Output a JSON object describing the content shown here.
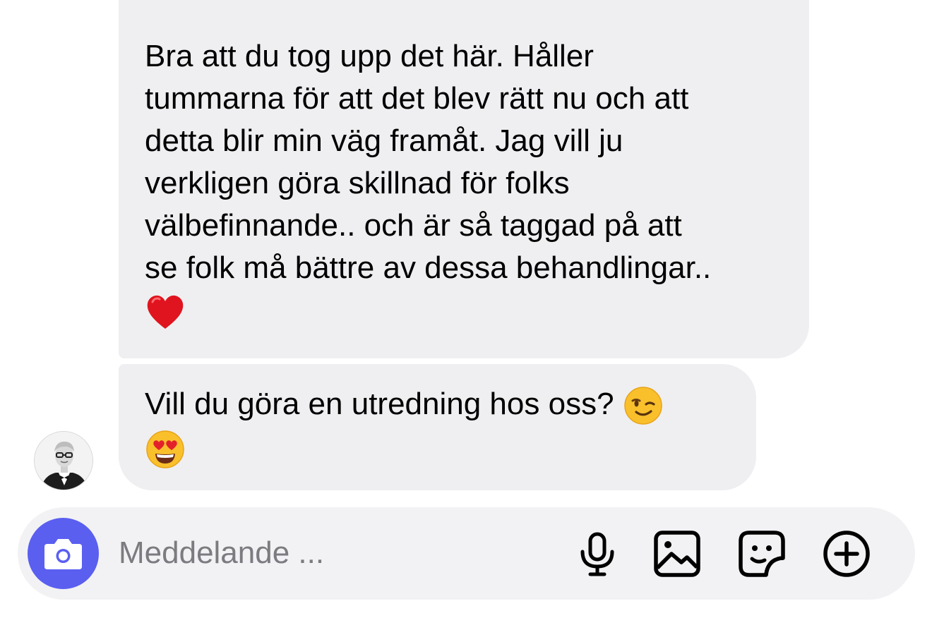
{
  "messages": [
    {
      "lines": [
        "Bra att du tog upp det här. Håller",
        "tummarna för att det blev rätt nu och att",
        "detta blir min väg framåt. Jag vill ju",
        "verkligen göra skillnad för folks",
        "välbefinnande.. och är så taggad på att",
        "se folk må bättre av dessa behandlingar.."
      ],
      "emoji": "❤️"
    },
    {
      "lines": [
        "Vill du göra en utredning hos oss?"
      ],
      "emoji_inline": "😉",
      "emoji": "😍"
    }
  ],
  "composer": {
    "placeholder": "Meddelande ...",
    "value": ""
  },
  "icons": {
    "camera": "camera-icon",
    "microphone": "microphone-icon",
    "gallery": "image-icon",
    "sticker": "sticker-icon",
    "add": "plus-circle-icon"
  },
  "colors": {
    "bubble": "#efeff1",
    "composer": "#f2f2f4",
    "camera_button": "#5a5ff0",
    "placeholder": "#7b7b80"
  }
}
